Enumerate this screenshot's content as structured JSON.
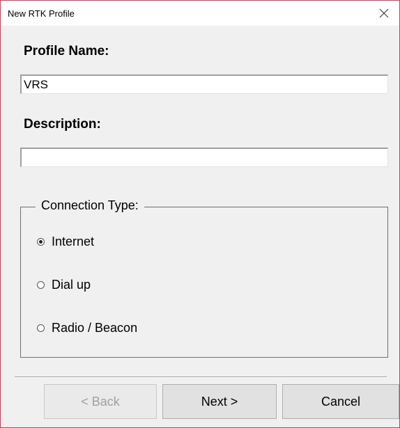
{
  "window": {
    "title": "New RTK Profile"
  },
  "profile_name": {
    "label": "Profile Name:",
    "value": "VRS"
  },
  "description": {
    "label": "Description:",
    "value": ""
  },
  "connection_type": {
    "legend": "Connection Type:",
    "selected": "Internet",
    "options": [
      {
        "label": "Internet",
        "checked": true
      },
      {
        "label": "Dial up",
        "checked": false
      },
      {
        "label": "Radio / Beacon",
        "checked": false
      }
    ]
  },
  "buttons": {
    "back_label": "< Back",
    "back_enabled": false,
    "next_label": "Next >",
    "cancel_label": "Cancel"
  },
  "icons": {
    "close": "close-icon"
  }
}
